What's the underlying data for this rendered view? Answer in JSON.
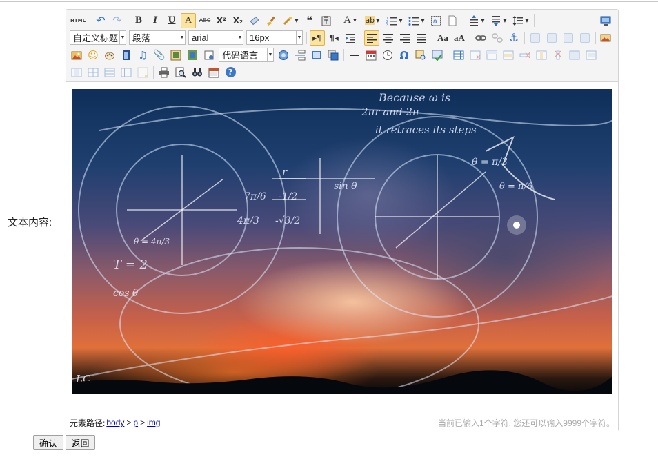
{
  "form": {
    "content_label": "文本内容:",
    "confirm_label": "确认",
    "back_label": "返回"
  },
  "toolbar": {
    "source_label": "HTML",
    "bold": "B",
    "italic": "I",
    "underline": "U",
    "fontborder": "A",
    "strikethrough": "ABC",
    "superscript": "X²",
    "subscript": "X₂",
    "blockquote": "❝",
    "forecolor": "A",
    "backcolor": "ab",
    "customstyle_value": "自定义标题",
    "paragraph_value": "段落",
    "fontfamily_value": "arial",
    "fontsize_value": "16px",
    "code_language_value": "代码语言",
    "special_char": "Ω",
    "help": "?",
    "brand_color": "#3a78c9",
    "active_color": "#fbe3a0"
  },
  "picture": {
    "handwriting": [
      "Because ω is",
      "2πr and 2π",
      "it retraces its steps",
      "θ = π/3",
      "θ = π/6",
      "sin θ",
      "cos θ",
      "r",
      "7π/6",
      "-1/2",
      "4π/3",
      "-√3/2",
      "θ = 4π/3",
      "T = 2",
      "LC"
    ]
  },
  "status": {
    "path_label": "元素路径:",
    "path": [
      "body",
      "p",
      "img"
    ],
    "path_sep": ">",
    "counter": "当前已输入1个字符, 您还可以输入9999个字符。"
  }
}
